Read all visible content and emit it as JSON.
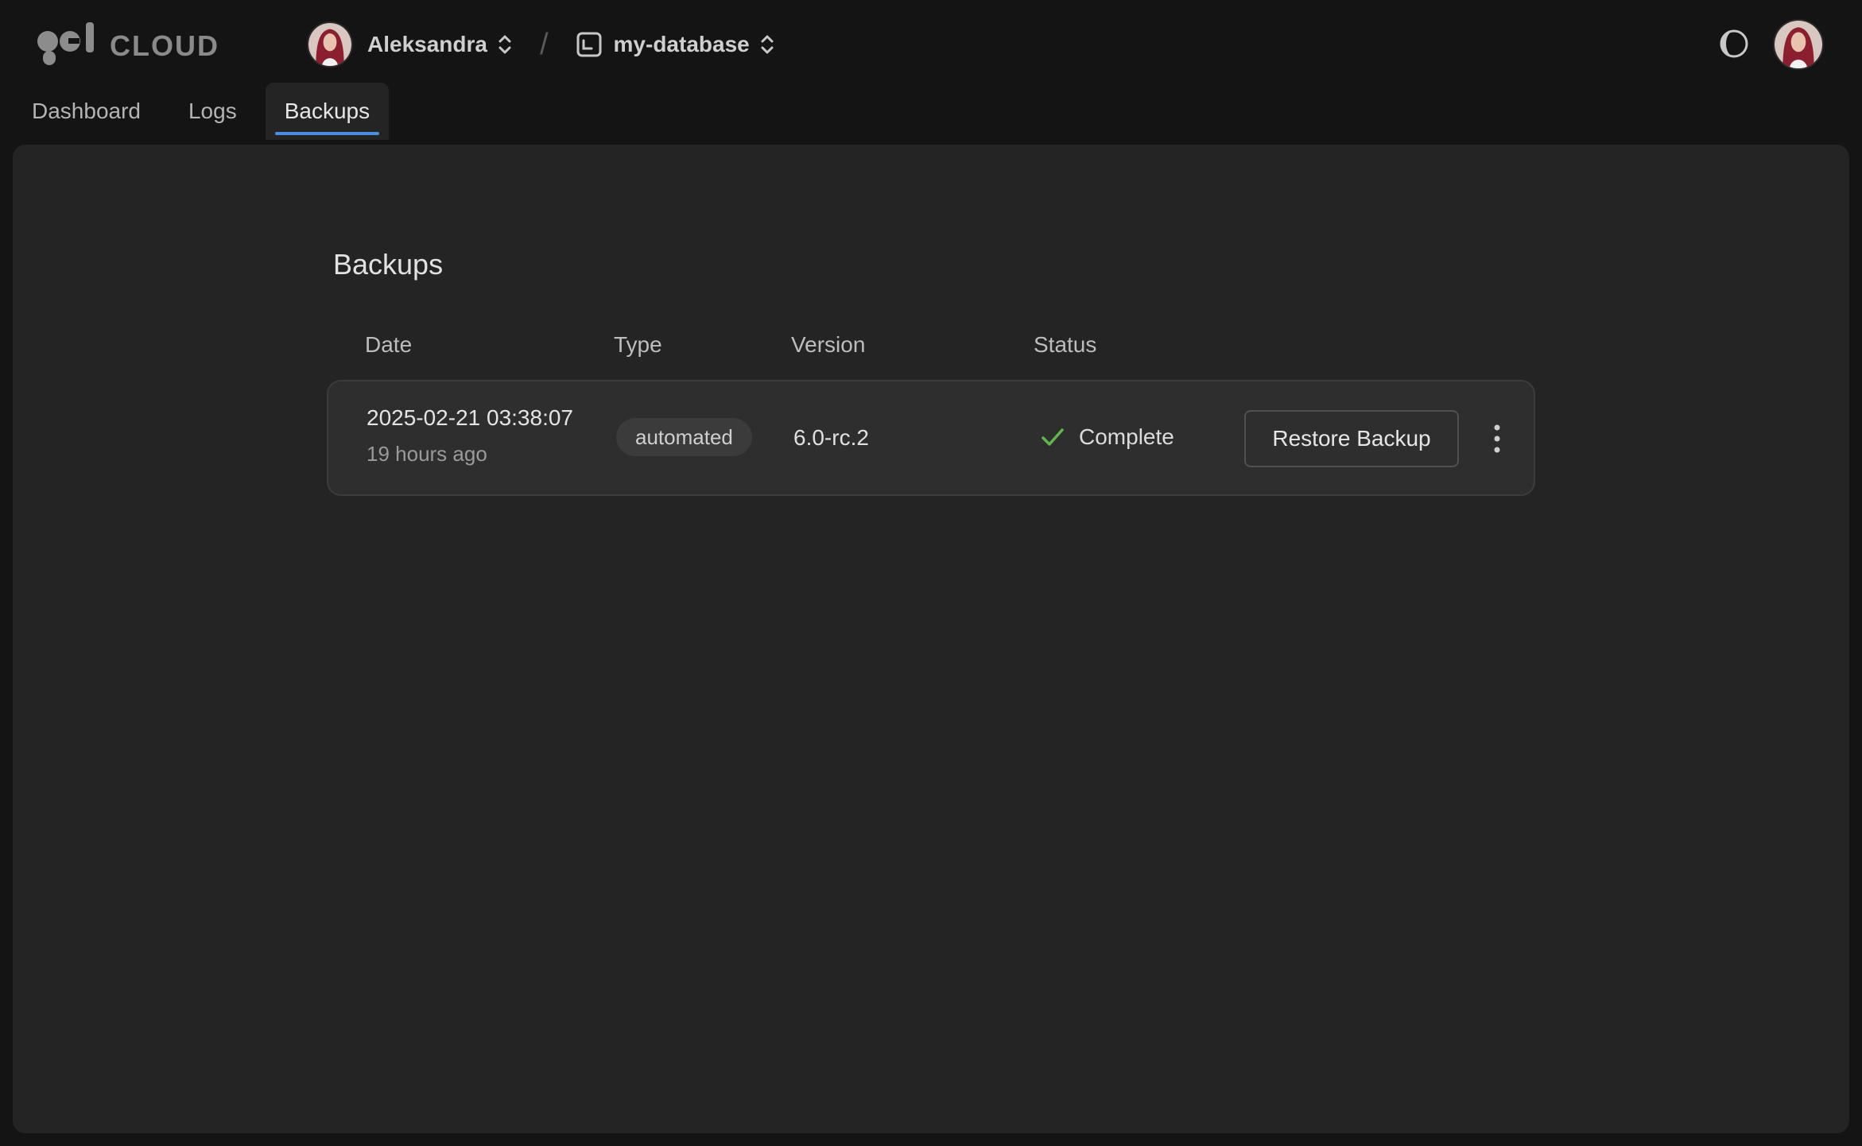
{
  "app": {
    "brand_text": "CLOUD"
  },
  "breadcrumb": {
    "org_name": "Aleksandra",
    "separator": "/",
    "database_name": "my-database"
  },
  "tabs": [
    {
      "label": "Dashboard",
      "active": false
    },
    {
      "label": "Logs",
      "active": false
    },
    {
      "label": "Backups",
      "active": true
    }
  ],
  "page": {
    "title": "Backups"
  },
  "table": {
    "columns": [
      "Date",
      "Type",
      "Version",
      "Status"
    ],
    "rows": [
      {
        "date": "2025-02-21 03:38:07",
        "relative_time": "19 hours ago",
        "type": "automated",
        "version": "6.0-rc.2",
        "status": "Complete",
        "action_label": "Restore Backup"
      }
    ]
  },
  "colors": {
    "accent": "#4b8ee8",
    "status_complete": "#5fb84a",
    "panel_bg": "#242424",
    "page_bg": "#141414"
  },
  "icons": {
    "theme_toggle": "half-moon-icon",
    "database": "database-icon",
    "status": "check-icon",
    "row_menu": "more-vertical-icon",
    "breadcrumb_switch": "chevron-up-down-icon"
  }
}
